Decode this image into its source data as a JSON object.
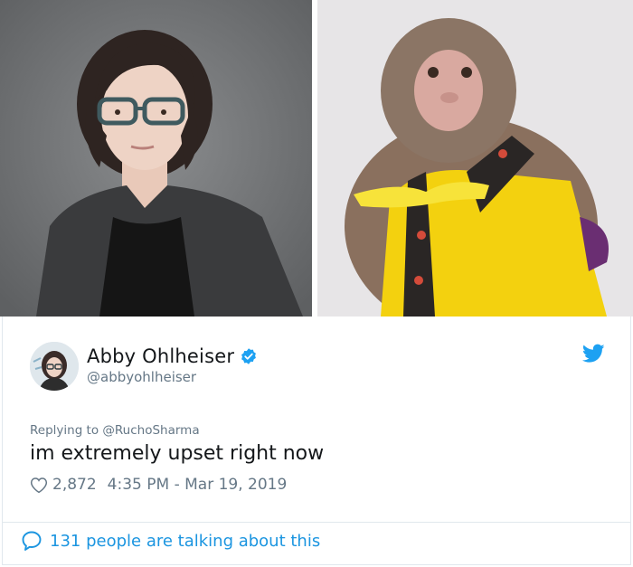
{
  "colors": {
    "accent": "#1da1f2",
    "link": "#1b95e0",
    "text_primary": "#14171a",
    "text_secondary": "#657786",
    "border": "#e1e8ed"
  },
  "images": {
    "left": {
      "icon": "woman-portrait-photo"
    },
    "right": {
      "icon": "monkey-in-costume-photo"
    }
  },
  "tweet": {
    "display_name": "Abby Ohlheiser",
    "handle": "@abbyohlheiser",
    "verified_icon": "verified-badge-icon",
    "platform_icon": "twitter-bird-icon",
    "replying_prefix": "Replying to",
    "replying_to": "@RuchoSharma",
    "text": "im extremely upset right now",
    "likes": "2,872",
    "timestamp": "4:35 PM - Mar 19, 2019",
    "like_icon": "heart-icon"
  },
  "footer": {
    "talking_text": "131 people are talking about this",
    "icon": "speech-bubble-icon"
  }
}
